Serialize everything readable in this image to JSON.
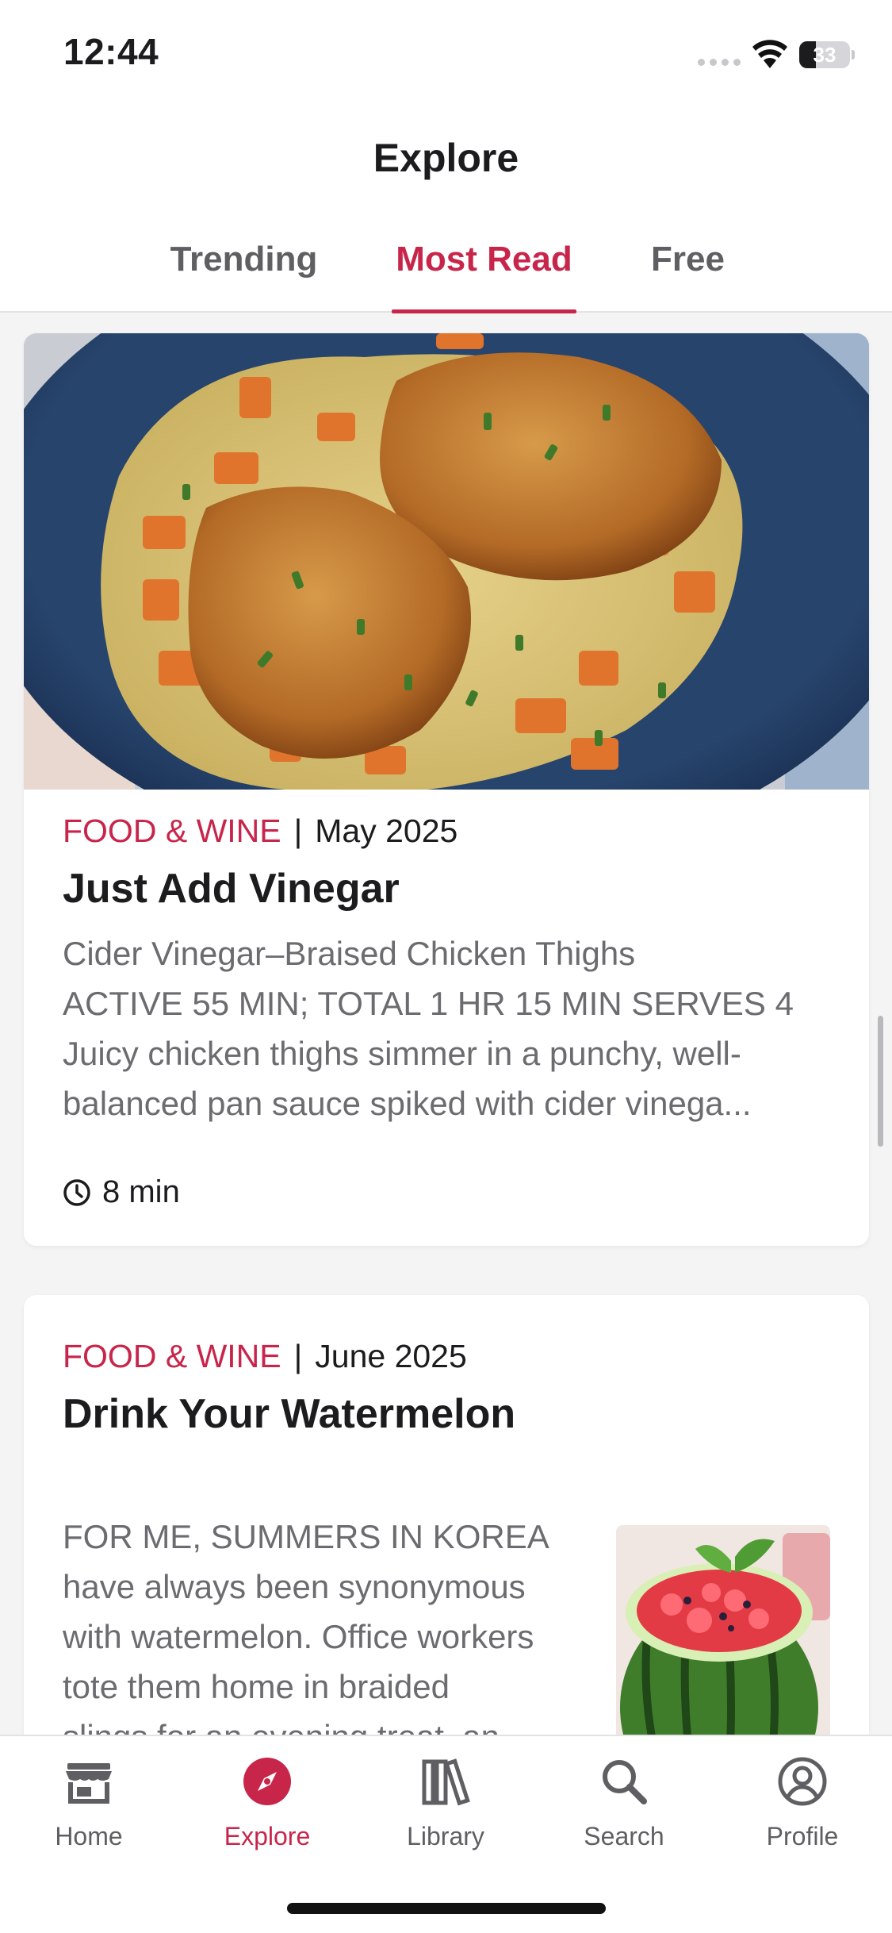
{
  "status_bar": {
    "time": "12:44",
    "battery_level": "33",
    "icons": [
      "cellular-signal-icon",
      "wifi-icon",
      "battery-icon"
    ]
  },
  "header": {
    "title": "Explore",
    "tabs": [
      {
        "label": "Trending",
        "active": false
      },
      {
        "label": "Most Read",
        "active": true
      },
      {
        "label": "Free",
        "active": false
      }
    ]
  },
  "articles": [
    {
      "publication": "FOOD & WINE",
      "separator": "|",
      "date": "May 2025",
      "title": "Just Add Vinegar",
      "description_lines": [
        "Cider Vinegar–Braised Chicken Thighs",
        "ACTIVE 55 MIN; TOTAL 1 HR 15 MIN SERVES 4",
        "Juicy chicken thighs simmer in a punchy, well-",
        "balanced pan sauce spiked with cider vinega..."
      ],
      "read_time": "8 min",
      "image": "braised-chicken-thighs-photo"
    },
    {
      "publication": "FOOD & WINE",
      "separator": "|",
      "date": "June 2025",
      "title": "Drink Your Watermelon",
      "description_lines": [
        "FOR ME, SUMMERS IN KOREA",
        "have always been synonymous",
        "with watermelon. Office workers",
        "tote them home in braided",
        "slings for an evening treat, an"
      ],
      "image": "watermelon-punch-photo"
    }
  ],
  "tabbar": {
    "items": [
      {
        "label": "Home",
        "icon": "home-icon",
        "active": false
      },
      {
        "label": "Explore",
        "icon": "compass-icon",
        "active": true
      },
      {
        "label": "Library",
        "icon": "library-icon",
        "active": false
      },
      {
        "label": "Search",
        "icon": "search-icon",
        "active": false
      },
      {
        "label": "Profile",
        "icon": "profile-icon",
        "active": false
      }
    ]
  },
  "colors": {
    "accent": "#c8254b",
    "text": "#1c1c1e",
    "secondary_text": "#6b6b70",
    "background": "#f4f4f5"
  }
}
